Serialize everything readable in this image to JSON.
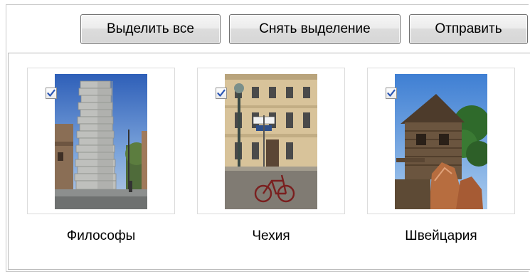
{
  "toolbar": {
    "select_all_label": "Выделить все",
    "deselect_label": "Снять выделение",
    "send_label": "Отправить"
  },
  "gallery": {
    "items": [
      {
        "caption": "Философы",
        "checked": true,
        "image": "tower-of-stacked-stone-books-photo"
      },
      {
        "caption": "Чехия",
        "checked": true,
        "image": "street-with-bicycle-and-lamp-post-photo"
      },
      {
        "caption": "Швейцария",
        "checked": true,
        "image": "wooden-chalet-with-rocks-photo"
      }
    ]
  },
  "colors": {
    "checkmark": "#2c57b5",
    "button_border": "#707070",
    "frame_border": "#b8b8b8"
  }
}
